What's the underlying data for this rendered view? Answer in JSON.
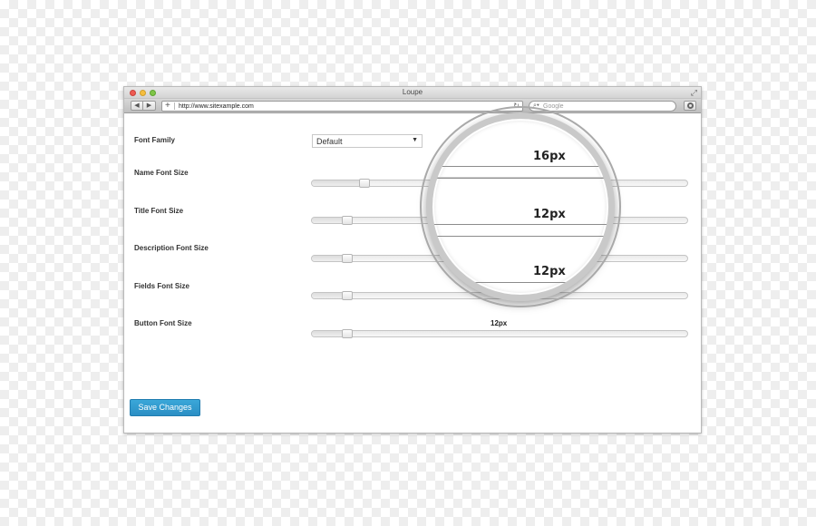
{
  "window": {
    "title": "Loupe",
    "url": "http://www.sitexample.com",
    "search_placeholder": "Google",
    "nav_back": "◀",
    "nav_forward": "▶"
  },
  "form": {
    "font_family": {
      "label": "Font Family",
      "value": "Default"
    },
    "name_font_size": {
      "label": "Name Font Size",
      "value": "16px",
      "level": 0.125
    },
    "title_font_size": {
      "label": "Title Font Size",
      "value": "12px",
      "level": 0.08
    },
    "description_font_size": {
      "label": "Description Font Size",
      "value": "12px",
      "level": 0.08
    },
    "fields_font_size": {
      "label": "Fields Font Size",
      "value": "12px",
      "level": 0.08
    },
    "button_font_size": {
      "label": "Button Font Size",
      "value": "12px",
      "level": 0.08
    },
    "save_label": "Save Changes"
  },
  "icons": {
    "plus": "plus-icon",
    "reload": "reload-icon",
    "search": "search-icon",
    "settings": "settings-icon",
    "resize": "resize-icon"
  },
  "colors": {
    "accent": "#2b9bd0"
  }
}
